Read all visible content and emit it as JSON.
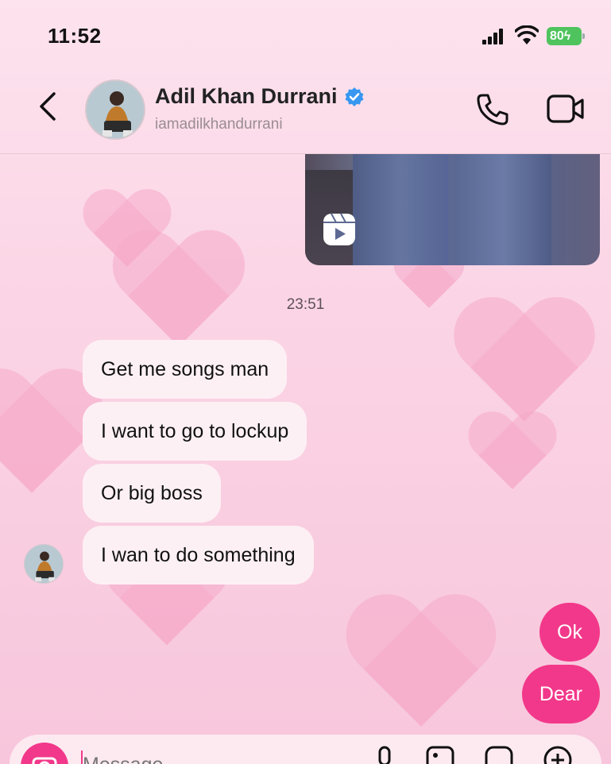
{
  "status_bar": {
    "time": "11:52",
    "battery": "80"
  },
  "header": {
    "name": "Adil Khan Durrani",
    "handle": "iamadilkhandurrani",
    "verified": true
  },
  "chat": {
    "timestamp": "23:51",
    "incoming": [
      "Get me songs man",
      "I want to go to lockup",
      "Or big boss",
      "I wan to do something"
    ],
    "outgoing": [
      "Ok",
      "Dear"
    ]
  },
  "composer": {
    "placeholder": "Message..."
  },
  "colors": {
    "accent": "#f2388a",
    "verified": "#3897f0",
    "battery": "#4fc35d"
  }
}
